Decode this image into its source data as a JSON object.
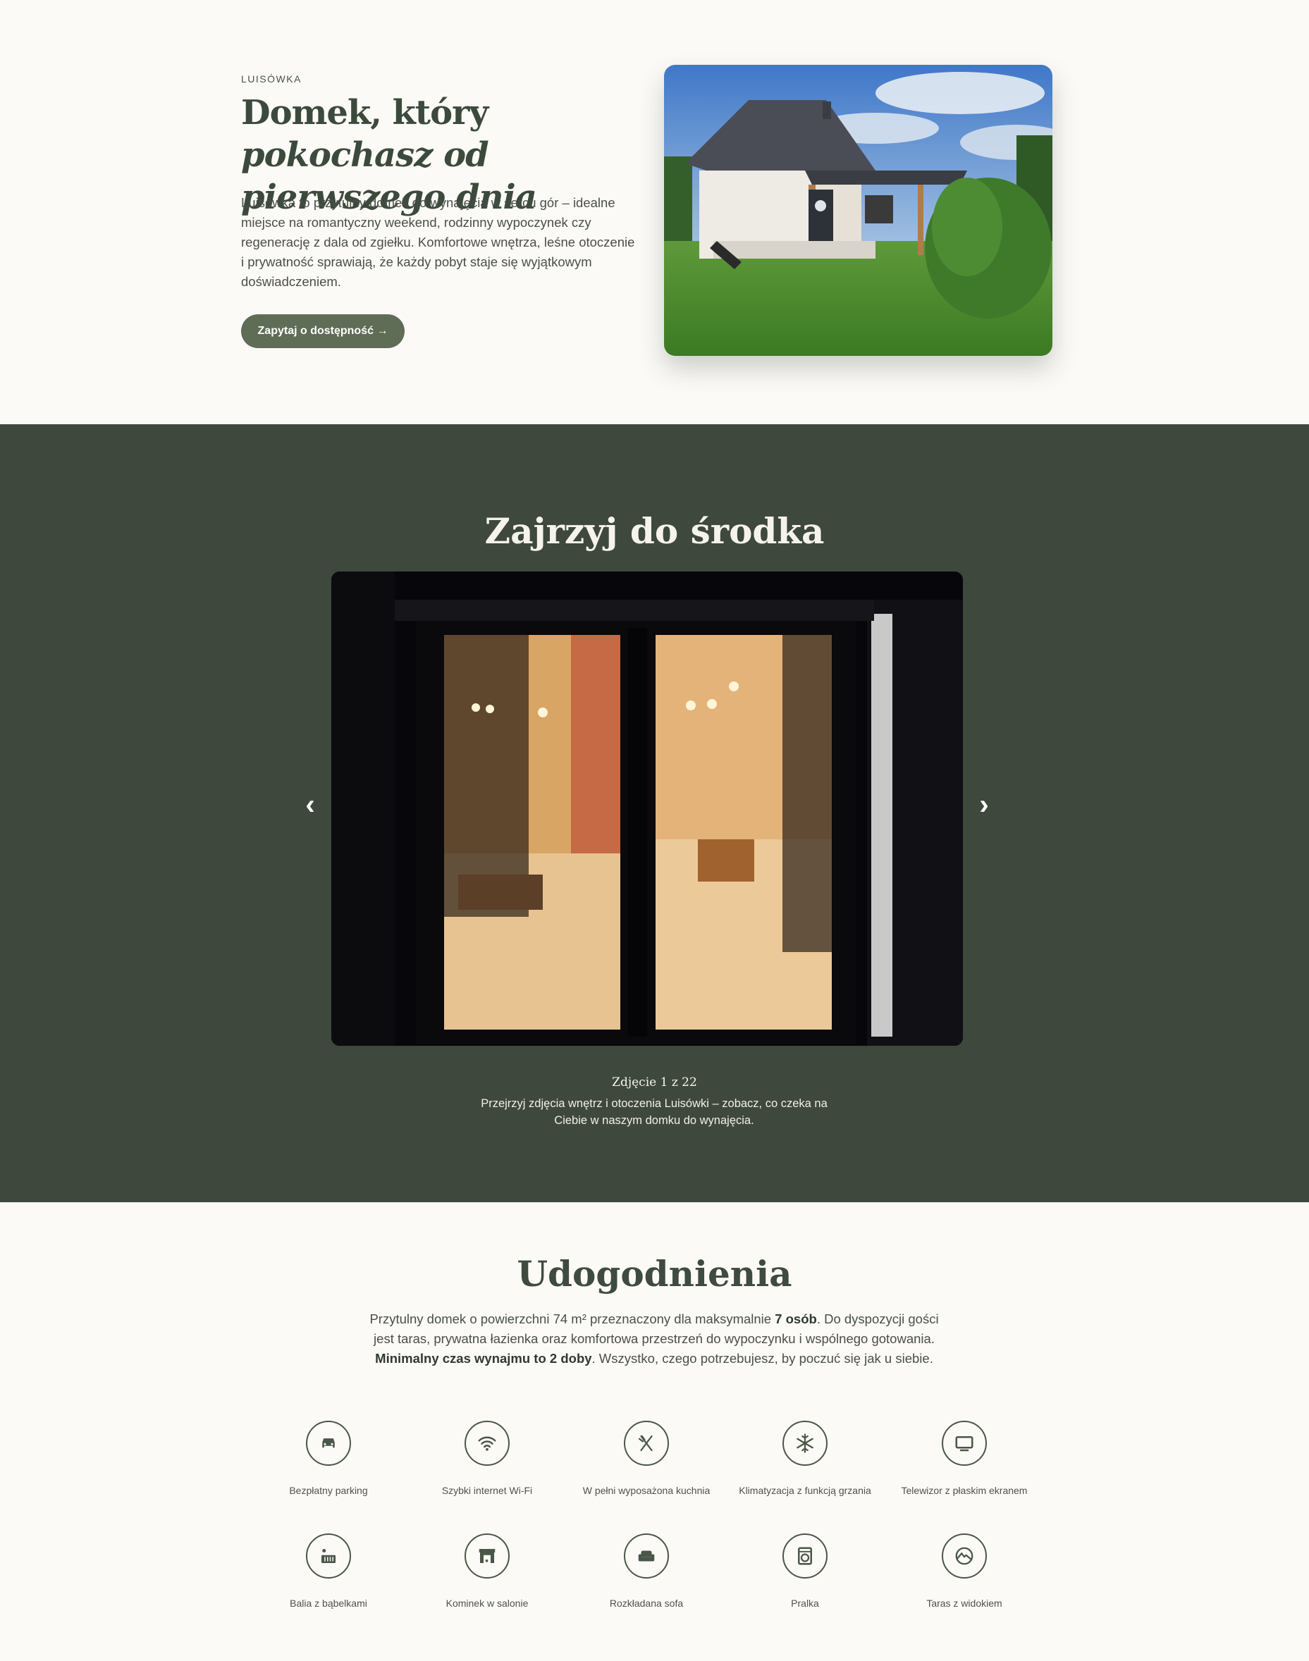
{
  "hero": {
    "eyebrow": "LUISÓWKA",
    "title_plain": "Domek, który",
    "title_italic": "pokochasz od pierwszego dnia",
    "description": "Luisówka to przytulny domek do wynajęcia w sercu gór – idealne miejsce na romantyczny weekend, rodzinny wypoczynek czy regenerację z dala od zgiełku. Komfortowe wnętrza, leśne otoczenie i prywatność sprawiają, że każdy pobyt staje się wyjątkowym doświadczeniem.",
    "cta_label": "Zapytaj o dostępność →"
  },
  "gallery": {
    "title": "Zajrzyj do środka",
    "counter": "Zdjęcie 1 z 22",
    "description": "Przejrzyj zdjęcia wnętrz i otoczenia Luisówki – zobacz, co czeka na Ciebie w naszym domku do wynajęcia.",
    "prev_icon": "chevron-left-icon",
    "next_icon": "chevron-right-icon"
  },
  "amenities": {
    "title": "Udogodnienia",
    "desc_1": "Przytulny domek o powierzchni 74 m² przeznaczony dla maksymalnie ",
    "desc_bold_1": "7 osób",
    "desc_2": ". Do dyspozycji gości jest taras, prywatna łazienka oraz komfortowa przestrzeń do wypoczynku i wspólnego gotowania. ",
    "desc_bold_2": "Minimalny czas wynajmu to 2 doby",
    "desc_3": ". Wszystko, czego potrzebujesz, by poczuć się jak u siebie.",
    "items": [
      {
        "label": "Bezpłatny parking",
        "icon": "car-icon"
      },
      {
        "label": "Szybki internet Wi-Fi",
        "icon": "wifi-icon"
      },
      {
        "label": "W pełni wyposażona kuchnia",
        "icon": "utensils-icon"
      },
      {
        "label": "Klimatyzacja z funkcją grzania",
        "icon": "snowflake-icon"
      },
      {
        "label": "Telewizor z płaskim ekranem",
        "icon": "tv-icon"
      },
      {
        "label": "Balia z bąbelkami",
        "icon": "hot-tub-icon"
      },
      {
        "label": "Kominek w salonie",
        "icon": "fireplace-icon"
      },
      {
        "label": "Rozkładana sofa",
        "icon": "sofa-icon"
      },
      {
        "label": "Pralka",
        "icon": "washing-machine-icon"
      },
      {
        "label": "Taras z widokiem",
        "icon": "mountain-view-icon"
      }
    ]
  },
  "colors": {
    "background": "#fbfaf7",
    "dark_green": "#3e483d",
    "button": "#5f6c56",
    "heading": "#3c4a3c"
  }
}
